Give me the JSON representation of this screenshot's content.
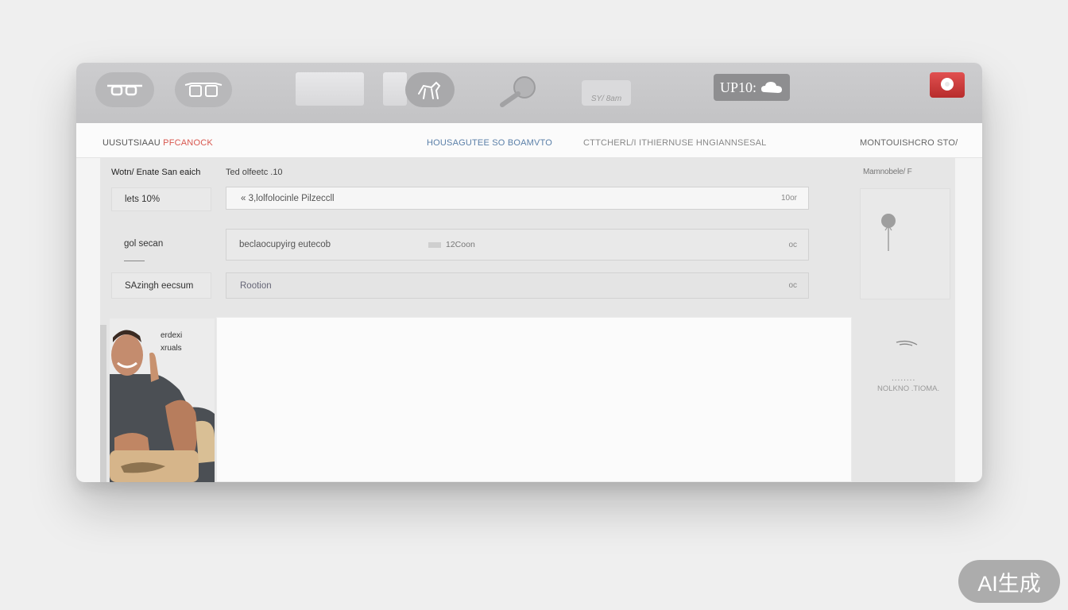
{
  "toolbar": {
    "badge_text": "UP10:",
    "pill_text": "SY/ 8am",
    "icons": [
      "glasses-icon",
      "sunglasses-icon",
      "horse-icon",
      "magnifier-icon",
      "cloud-icon",
      "record-icon"
    ]
  },
  "navbar": {
    "brand_a": "UUSUTSIAAU",
    "brand_b": " PFCANOCK",
    "link_1": "HOUSAGUTEE SO BOAMVTO",
    "link_2": "CTTCHERL/I ITHIERNUSE  HNGIANNSESAL",
    "link_3": "MONTOUISHCRO  STO/"
  },
  "form": {
    "title": "Wotn/ Enate San eaich",
    "subtitle": "Ted olfeetc .10",
    "rows": [
      {
        "label": "lets  10%",
        "value": "« 3,lolfolocinle Pilzeccll",
        "suffix": "10or"
      },
      {
        "label": "gol secan",
        "value": "beclaocupyirg eutecob",
        "mid": "12Coon",
        "suffix": "oc"
      },
      {
        "label": "SAzingh eecsum",
        "value": "Rootion",
        "suffix": "oc"
      }
    ]
  },
  "side": {
    "label": "Mamnobele/ F",
    "dots": "........",
    "text": "NOLKNO .TIOMA."
  },
  "photo": {
    "caption_1": "erdexi",
    "caption_2": "xruals"
  },
  "colors": {
    "accent_red": "#d8574f",
    "accent_blue": "#5a7fa8",
    "toolbar_bg": "#c8c8ca"
  },
  "watermark": "AI生成"
}
